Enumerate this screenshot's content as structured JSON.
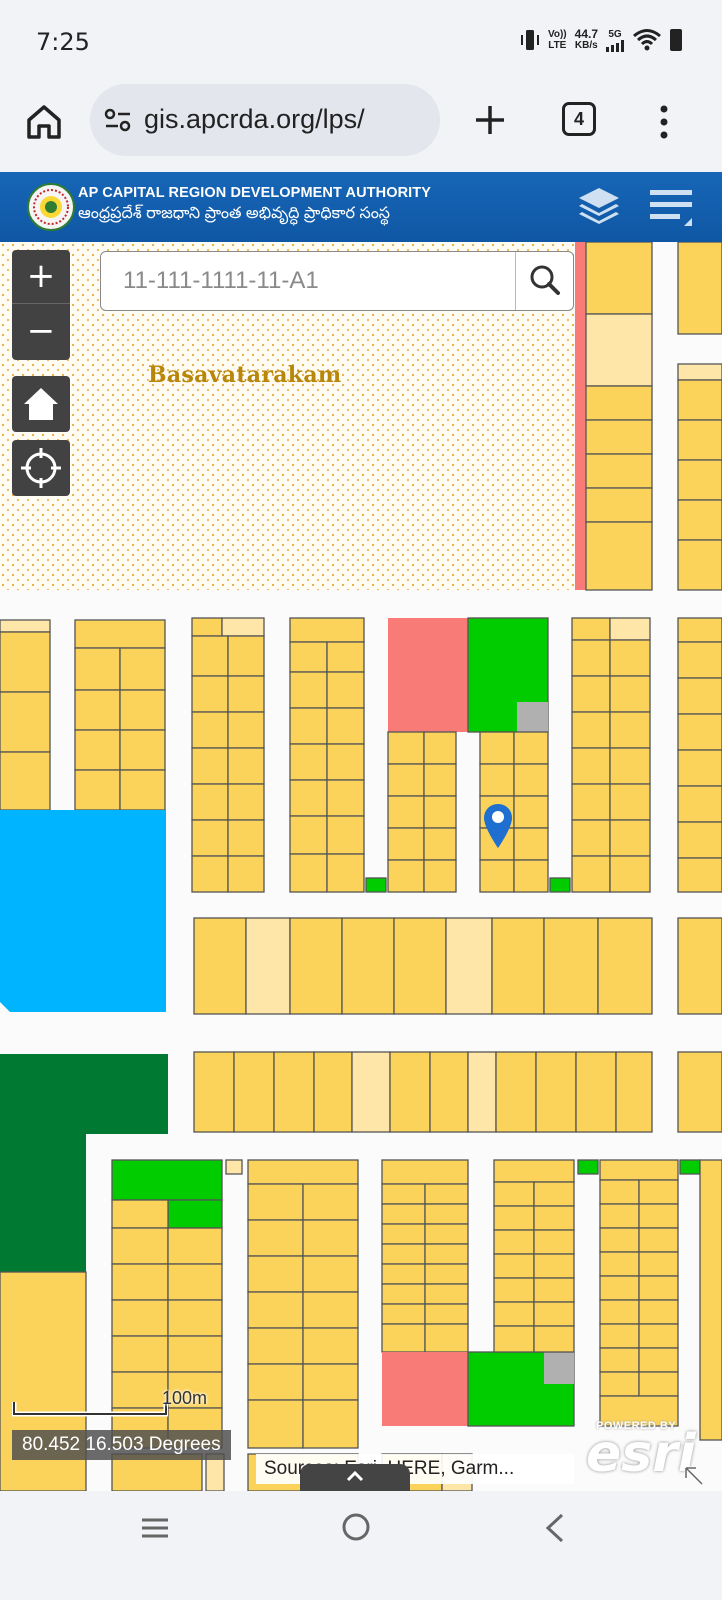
{
  "status_bar": {
    "time": "7:25",
    "network_top": "Vo))",
    "network_bottom": "LTE",
    "speed_value": "44.7",
    "speed_unit": "KB/s",
    "net_type": "5G"
  },
  "browser": {
    "url": "gis.apcrda.org/lps/",
    "tab_count": "4"
  },
  "header": {
    "title": "AP CAPITAL REGION DEVELOPMENT AUTHORITY",
    "subtitle": "ఆంధ్రప్రదేశ్ రాజధాని ప్రాంత అభివృద్ధి ప్రాధికార సంస్థ"
  },
  "map": {
    "search_placeholder": "11-111-1111-11-A1",
    "zoom_in_label": "+",
    "zoom_out_label": "−",
    "place_label": "Basavatarakam",
    "scale_label": "100m",
    "coordinates": "80.452 16.503 Degrees",
    "attribution": "Sources: Esri, HERE, Garm...",
    "esri_powered": "POWERED BY",
    "esri_brand": "esri"
  },
  "colors": {
    "plot": "#fbd35b",
    "plot_light": "#fde6a7",
    "commercial": "#f87b78",
    "park": "#00cc00",
    "forest": "#007a33",
    "water": "#00b4ff",
    "utility": "#b0b0b0",
    "header_blue": "#1565c0"
  }
}
